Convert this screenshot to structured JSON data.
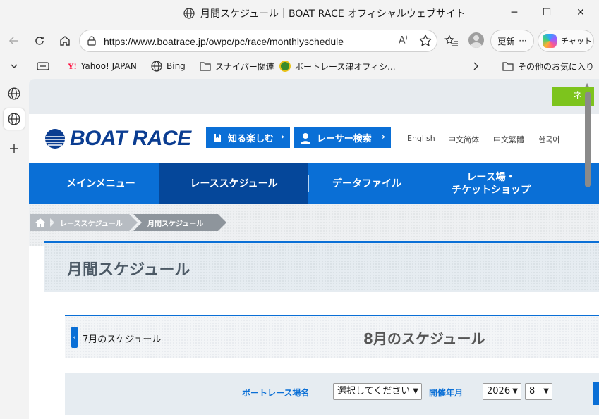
{
  "window": {
    "title": "月間スケジュール｜BOAT RACE オフィシャルウェブサイト",
    "minimize": "─",
    "maximize": "☐",
    "close": "✕"
  },
  "browser": {
    "url": "https://www.boatrace.jp/owpc/pc/race/monthlyschedule",
    "read_aloud": "Aͅ",
    "update_label": "更新",
    "more_label": "···",
    "copilot_label": "チャット"
  },
  "favorites": [
    {
      "label": "",
      "icon": "card-icon"
    },
    {
      "label": "Yahoo! JAPAN",
      "icon": "yahoo-icon"
    },
    {
      "label": "Bing",
      "icon": "globe-icon"
    },
    {
      "label": "スナイパー関連",
      "icon": "folder-icon"
    },
    {
      "label": "ボートレース津オフィシ...",
      "icon": "tsu-icon"
    }
  ],
  "favorites_other": "その他のお気に入り",
  "site": {
    "promo_button": "ネ",
    "logo_text": "BOAT RACE",
    "header_buttons": {
      "enjoy": "知る楽しむ",
      "racer_search": "レーサー検索"
    },
    "languages": [
      "English",
      "中文简体",
      "中文繁體",
      "한국어"
    ],
    "main_nav": [
      {
        "label": "メインメニュー",
        "active": false
      },
      {
        "label": "レーススケジュール",
        "active": true
      },
      {
        "label": "データファイル",
        "active": false
      },
      {
        "label": "レース場・\nチケットショップ",
        "active": false
      }
    ],
    "breadcrumb": [
      "レーススケジュール",
      "月間スケジュール"
    ],
    "page_title": "月間スケジュール",
    "prev_month_label": "7月のスケジュール",
    "month_title": "8月のスケジュール",
    "search": {
      "venue_label": "ボートレース場名",
      "venue_select": "選択してください",
      "period_label": "開催年月",
      "year": "2026",
      "month": "8"
    }
  },
  "colors": {
    "brand_blue": "#0a6fd6",
    "nav_active": "#05479a",
    "promo_green": "#7dc41d",
    "logo_navy": "#0b3d91"
  }
}
